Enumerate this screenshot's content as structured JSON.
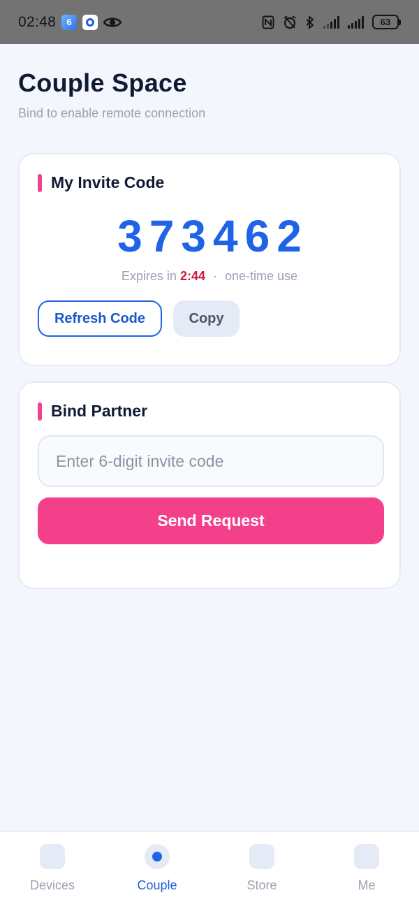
{
  "status_bar": {
    "time": "02:48",
    "app_badge_text": "6",
    "battery": "63"
  },
  "header": {
    "title": "Couple Space",
    "subtitle": "Bind to enable remote connection"
  },
  "invite_card": {
    "title": "My Invite Code",
    "code": "373462",
    "expiry_prefix": "Expires in",
    "expiry_time": "2:44",
    "expiry_separator": "·",
    "expiry_suffix": "one-time use",
    "refresh_label": "Refresh Code",
    "copy_label": "Copy"
  },
  "bind_card": {
    "title": "Bind Partner",
    "input_placeholder": "Enter 6-digit invite code",
    "input_value": "",
    "send_label": "Send Request"
  },
  "tabs": [
    {
      "label": "Devices",
      "active": false
    },
    {
      "label": "Couple",
      "active": true
    },
    {
      "label": "Store",
      "active": false
    },
    {
      "label": "Me",
      "active": false
    }
  ],
  "colors": {
    "accent_pink": "#f4408a",
    "primary_blue": "#1f63e6",
    "expiry_red": "#d0183e",
    "background": "#f3f6fc"
  }
}
